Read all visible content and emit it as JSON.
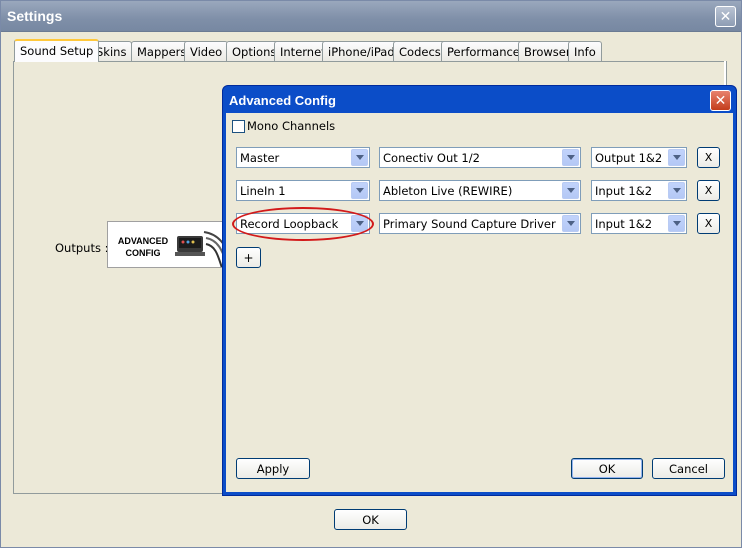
{
  "settings": {
    "title": "Settings",
    "tabs": [
      {
        "label": "Sound Setup"
      },
      {
        "label": "Skins"
      },
      {
        "label": "Mappers"
      },
      {
        "label": "Video"
      },
      {
        "label": "Options"
      },
      {
        "label": "Internet"
      },
      {
        "label": "iPhone/iPad"
      },
      {
        "label": "Codecs"
      },
      {
        "label": "Performances"
      },
      {
        "label": "Browser"
      },
      {
        "label": "Info"
      }
    ],
    "active_tab": "Sound Setup",
    "outputs_label": "Outputs :",
    "advanced_logo_text": "ADVANCED\nCONFIG",
    "ok_label": "OK"
  },
  "advanced": {
    "title": "Advanced Config",
    "mono_label": "Mono Channels",
    "mono_checked": false,
    "rows": [
      {
        "channel": "Master",
        "device": "Conectiv Out 1/2",
        "io": "Output 1&2",
        "remove": "X"
      },
      {
        "channel": "LineIn 1",
        "device": "Ableton Live (REWIRE)",
        "io": "Input 1&2",
        "remove": "X"
      },
      {
        "channel": "Record Loopback",
        "device": "Primary Sound Capture Driver",
        "io": "Input 1&2",
        "remove": "X"
      }
    ],
    "add_label": "+",
    "apply_label": "Apply",
    "ok_label": "OK",
    "cancel_label": "Cancel",
    "highlight_color": "#d21a1a"
  },
  "colors": {
    "titlebar_settings": "#8594ac",
    "titlebar_dialog": "#0b4dc8",
    "face": "#ece9d8"
  }
}
